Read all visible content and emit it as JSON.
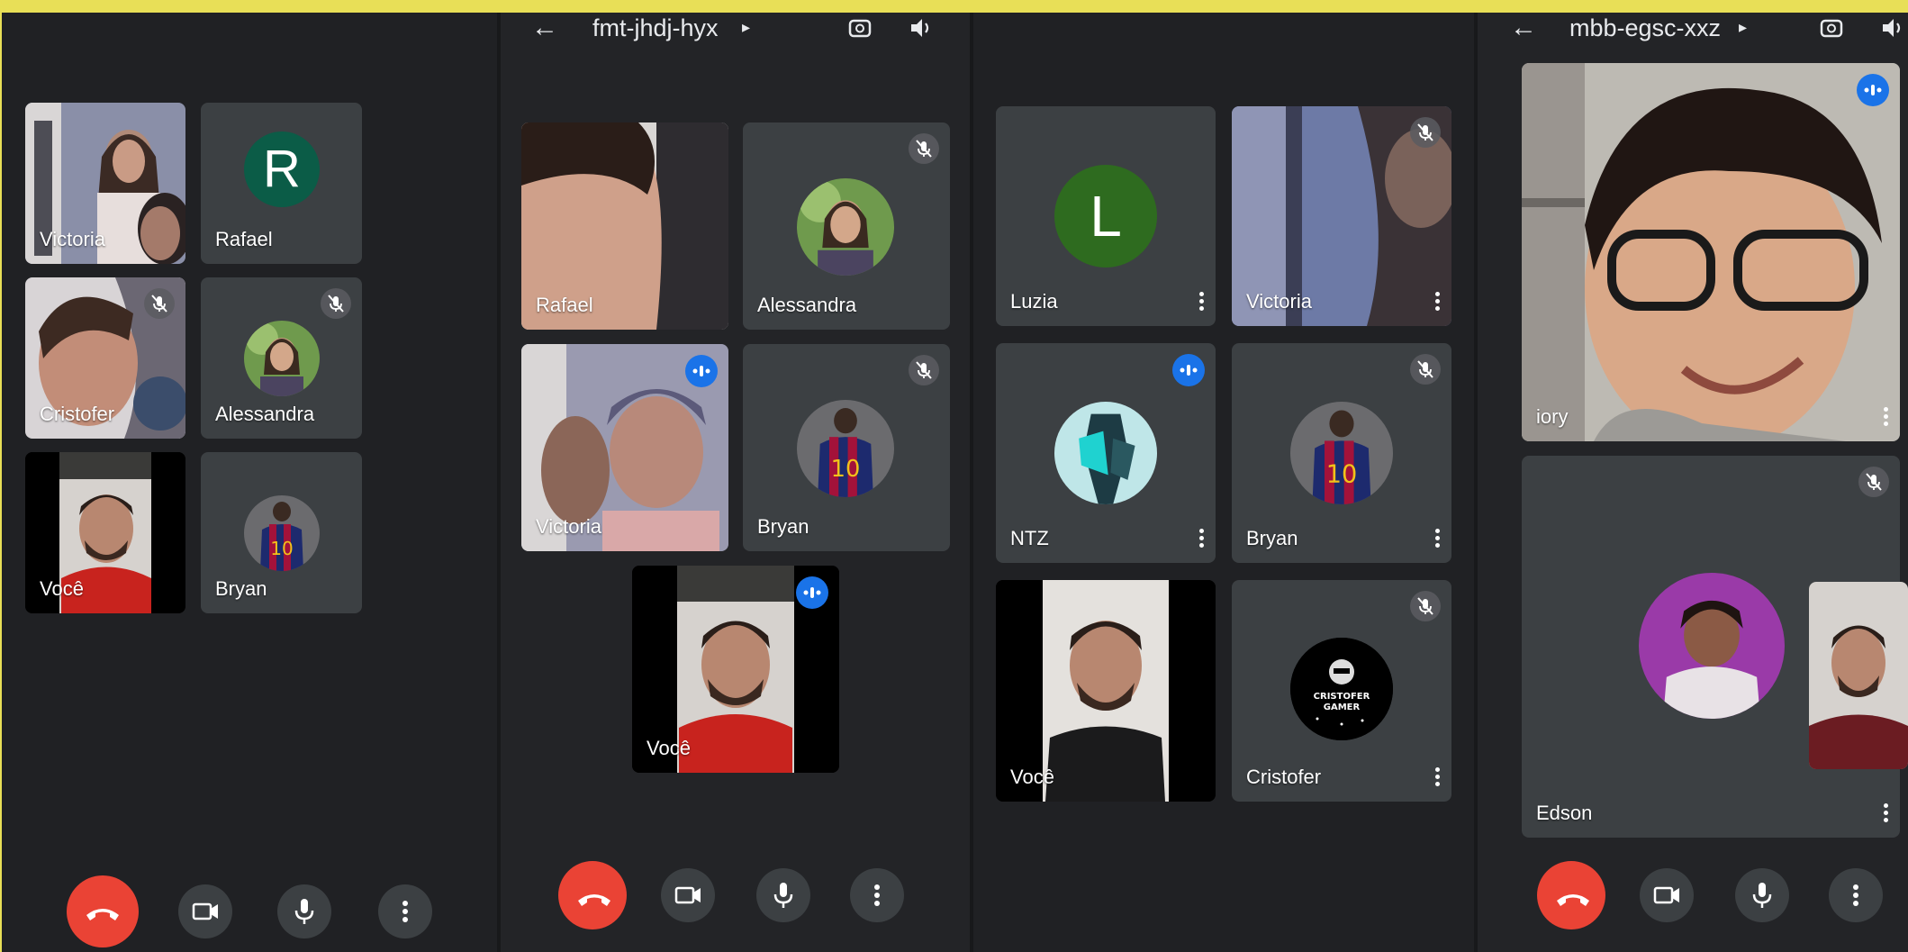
{
  "panels": [
    {
      "tiles": [
        {
          "name": "Victoria"
        },
        {
          "name": "Rafael",
          "initial": "R"
        },
        {
          "name": "Cristofer"
        },
        {
          "name": "Alessandra"
        },
        {
          "name": "Você"
        },
        {
          "name": "Bryan"
        }
      ]
    },
    {
      "meeting_code": "fmt-jhdj-hyx",
      "tiles": [
        {
          "name": "Rafael"
        },
        {
          "name": "Alessandra"
        },
        {
          "name": "Victoria"
        },
        {
          "name": "Bryan"
        },
        {
          "name": "Você"
        }
      ]
    },
    {
      "tiles": [
        {
          "name": "Luzia",
          "initial": "L"
        },
        {
          "name": "Victoria"
        },
        {
          "name": "NTZ"
        },
        {
          "name": "Bryan"
        },
        {
          "name": "Você"
        },
        {
          "name": "Cristofer",
          "avatar_text": [
            "CRISTOFER",
            "GAMER"
          ]
        }
      ]
    },
    {
      "meeting_code": "mbb-egsc-xxz",
      "tiles": [
        {
          "name": "iory"
        },
        {
          "name": "Edson"
        }
      ]
    }
  ],
  "icons": {
    "back": "arrow-left-icon",
    "switch_camera": "switch-camera-icon",
    "speaker": "speaker-icon",
    "mic_off": "mic-off-icon",
    "speaking": "speaking-indicator-icon",
    "end_call": "end-call-icon",
    "camera": "camera-icon",
    "mic": "mic-icon",
    "more": "more-vert-icon"
  },
  "colors": {
    "end_call": "#ea4335",
    "speaking": "#1a73e8",
    "avatar_r": "#0b5c47",
    "avatar_l": "#2e6b1f",
    "background_band": "#e8df57"
  }
}
